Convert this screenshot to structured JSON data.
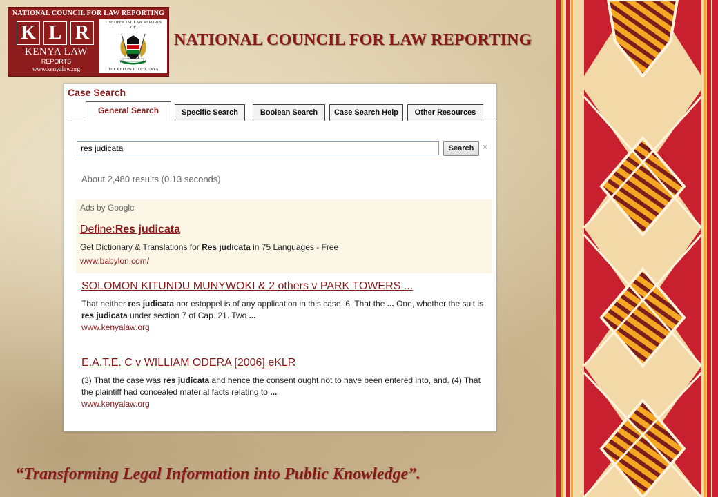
{
  "header": {
    "logo_top_text": "NATIONAL COUNCIL FOR LAW REPORTING",
    "klr_letters": [
      "K",
      "L",
      "R"
    ],
    "kenya_law": "KENYA LAW",
    "reports": "REPORTS",
    "website": "www.kenyalaw.org",
    "seal_top": "THE OFFICIAL LAW REPORTS",
    "seal_of": "OF",
    "seal_bottom": "THE REPUBLIC OF KENYA",
    "title": "NATIONAL COUNCIL FOR LAW REPORTING"
  },
  "case_search": {
    "title": "Case Search",
    "tabs": [
      {
        "label": "General Search",
        "active": true
      },
      {
        "label": "Specific Search",
        "active": false
      },
      {
        "label": "Boolean Search",
        "active": false
      },
      {
        "label": "Case Search Help",
        "active": false
      },
      {
        "label": "Other Resources",
        "active": false
      }
    ],
    "query": "res judicata",
    "search_button": "Search",
    "clear_icon": "×",
    "results_count": "About 2,480 results (0.13 seconds)"
  },
  "ads": {
    "label": "Ads by Google",
    "title_prefix": "Define:",
    "title_bold": "Res judicata",
    "desc_before": "Get Dictionary & Translations for ",
    "desc_bold": "Res judicata",
    "desc_after": " in 75 Languages - Free",
    "url": "www.babylon.com/"
  },
  "results": [
    {
      "title": "SOLOMON KITUNDU MUNYWOKI & 2 others v PARK TOWERS ...",
      "snippet_segments": [
        {
          "text": "That neither ",
          "bold": false
        },
        {
          "text": "res judicata",
          "bold": true
        },
        {
          "text": " nor estoppel is of any application in this case. 6. That the ",
          "bold": false
        },
        {
          "text": "...",
          "bold": true
        },
        {
          "text": " One, whether the suit is ",
          "bold": false
        },
        {
          "text": "res judicata",
          "bold": true
        },
        {
          "text": " under section 7 of Cap. 21. Two ",
          "bold": false
        },
        {
          "text": "...",
          "bold": true
        }
      ],
      "url": "www.kenyalaw.org"
    },
    {
      "title": "E.A.T.E. C v WILLIAM ODERA [2006] eKLR",
      "snippet_segments": [
        {
          "text": "(3) That the case was ",
          "bold": false
        },
        {
          "text": "res judicata",
          "bold": true
        },
        {
          "text": " and hence the consent ought not to have been entered into, and. (4) That the plaintiff had concealed material facts relating to ",
          "bold": false
        },
        {
          "text": "...",
          "bold": true
        }
      ],
      "url": "www.kenyalaw.org"
    }
  ],
  "footer": {
    "tagline": "“Transforming Legal Information into Public Knowledge”."
  },
  "colors": {
    "brand_red": "#8a1a1a",
    "deco_red": "#c8202f",
    "deco_orange": "#f5a623",
    "deco_dark": "#7a1d1d"
  },
  "icons": {
    "clear": "close-icon",
    "seal": "coat-of-arms-icon"
  }
}
